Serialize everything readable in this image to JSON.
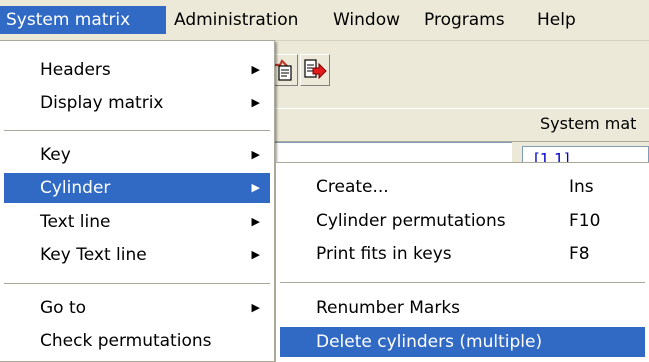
{
  "menubar": {
    "items": [
      {
        "label": "System matrix"
      },
      {
        "label": "Administration"
      },
      {
        "label": "Window"
      },
      {
        "label": "Programs"
      },
      {
        "label": "Help"
      }
    ]
  },
  "app": {
    "header_label": "System mat",
    "cell_label": "[1.1]"
  },
  "main_menu": {
    "items": [
      {
        "label": "Headers"
      },
      {
        "label": "Display matrix"
      },
      {
        "label": "Key"
      },
      {
        "label": "Cylinder"
      },
      {
        "label": "Text line"
      },
      {
        "label": "Key Text line"
      },
      {
        "label": "Go to"
      },
      {
        "label": "Check permutations"
      }
    ]
  },
  "sub_menu": {
    "items": [
      {
        "label": "Create...",
        "shortcut": "Ins"
      },
      {
        "label": "Cylinder permutations",
        "shortcut": "F10"
      },
      {
        "label": "Print fits in keys",
        "shortcut": "F8"
      },
      {
        "label": "Renumber Marks"
      },
      {
        "label": "Delete cylinders (multiple)"
      }
    ]
  },
  "colors": {
    "highlight": "#316ac5",
    "menu_bg": "#ffffff",
    "window_bg": "#ece9d8",
    "link_text": "#0000cc"
  },
  "icons": [
    "submenu-arrow-icon",
    "document-copy-icon",
    "document-export-icon"
  ]
}
